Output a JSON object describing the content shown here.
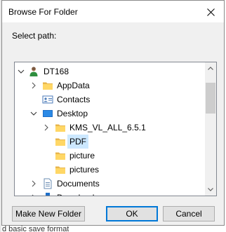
{
  "dialog": {
    "title": "Browse For Folder",
    "prompt": "Select path:"
  },
  "tree": {
    "items": [
      {
        "label": "DT168",
        "icon": "user-icon",
        "chevron": "down",
        "selected": false
      },
      {
        "label": "AppData",
        "icon": "folder-icon",
        "chevron": "right",
        "selected": false
      },
      {
        "label": "Contacts",
        "icon": "contacts-icon",
        "chevron": "none",
        "selected": false
      },
      {
        "label": "Desktop",
        "icon": "desktop-icon",
        "chevron": "down",
        "selected": false
      },
      {
        "label": "KMS_VL_ALL_6.5.1",
        "icon": "folder-icon",
        "chevron": "right",
        "selected": false
      },
      {
        "label": "PDF",
        "icon": "folder-icon",
        "chevron": "none",
        "selected": true
      },
      {
        "label": "picture",
        "icon": "folder-icon",
        "chevron": "none",
        "selected": false
      },
      {
        "label": "pictures",
        "icon": "folder-icon",
        "chevron": "none",
        "selected": false
      },
      {
        "label": "Documents",
        "icon": "documents-icon",
        "chevron": "right",
        "selected": false
      },
      {
        "label": "Downloads",
        "icon": "downloads-icon",
        "chevron": "right",
        "selected": false
      }
    ]
  },
  "buttons": {
    "new_folder": "Make New Folder",
    "ok": "OK",
    "cancel": "Cancel"
  },
  "background": {
    "bottom_text": "d basic save format"
  },
  "colors": {
    "selection": "#cce8ff",
    "folder": "#ffd766",
    "accent": "#0078d7"
  }
}
